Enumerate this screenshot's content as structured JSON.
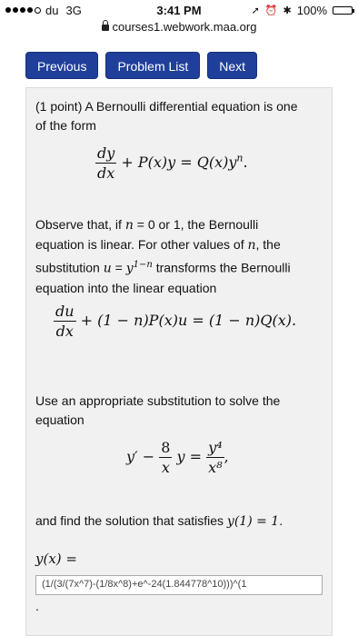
{
  "status_bar": {
    "carrier": "du",
    "network": "3G",
    "time": "3:41 PM",
    "battery": "100%"
  },
  "browser": {
    "url": "courses1.webwork.maa.org"
  },
  "nav": {
    "previous": "Previous",
    "problem_list": "Problem List",
    "next": "Next"
  },
  "problem": {
    "intro_a": "(1 point) A Bernoulli differential equation is one",
    "intro_b": "of the form",
    "eq1_lhs": "+ P(x)y = Q(x)y",
    "eq1_exp": "n",
    "eq1_end": ".",
    "frac_dy_num": "dy",
    "frac_dy_den": "dx",
    "observe_a1": "Observe that, if ",
    "observe_a_n": "n",
    "observe_a2": " = 0 or 1, the Bernoulli",
    "observe_b1": "equation is linear. For other values of ",
    "observe_b_n": "n",
    "observe_b2": ", the",
    "observe_c1": "substitution ",
    "observe_c_u": "u",
    "observe_c_eq": " = ",
    "observe_c_y": "y",
    "observe_c_exp": "1−n",
    "observe_c2": " transforms the Bernoulli",
    "observe_d": "equation into the linear equation",
    "frac_du_num": "du",
    "frac_du_den": "dx",
    "eq2_rest": "+ (1 − n)P(x)u = (1 − n)Q(x).",
    "use_a": "Use an appropriate substitution to solve the",
    "use_b": "equation",
    "eq3_yprime": "y′ −",
    "eq3_frac_num": "8",
    "eq3_frac_den": "x",
    "eq3_mid": "y =",
    "eq3_rhs_num": "y⁴",
    "eq3_rhs_den": "x⁸",
    "eq3_end": ",",
    "find_a": "and find the solution that satisfies ",
    "find_cond": "y(1) = 1",
    "find_end": ".",
    "answer_label": "y(x) =",
    "answer_value": "(1/(3/(7x^7)-(1/8x^8)+e^-24(1.844778^10)))^(1",
    "trailing": "."
  }
}
